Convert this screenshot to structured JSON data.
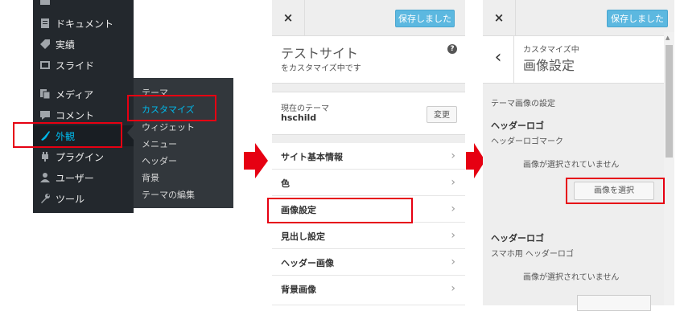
{
  "admin_menu": {
    "items": [
      {
        "label": "ドキュメント",
        "icon": "document-icon"
      },
      {
        "label": "実績",
        "icon": "tag-icon"
      },
      {
        "label": "スライド",
        "icon": "slides-icon"
      },
      {
        "label": "メディア",
        "icon": "media-icon"
      },
      {
        "label": "コメント",
        "icon": "comment-icon"
      },
      {
        "label": "外観",
        "icon": "brush-icon"
      },
      {
        "label": "プラグイン",
        "icon": "plugin-icon"
      },
      {
        "label": "ユーザー",
        "icon": "user-icon"
      },
      {
        "label": "ツール",
        "icon": "wrench-icon"
      }
    ],
    "submenu": [
      "テーマ",
      "カスタマイズ",
      "ウィジェット",
      "メニュー",
      "ヘッダー",
      "背景",
      "テーマの編集"
    ]
  },
  "customizer": {
    "close": "×",
    "saved": "保存しました",
    "site_title": "テストサイト",
    "site_subtitle": "をカスタマイズ中です",
    "help": "?",
    "current_theme_label": "現在のテーマ",
    "current_theme": "hschild",
    "change_button": "変更",
    "sections": [
      "サイト基本情報",
      "色",
      "画像設定",
      "見出し設定",
      "ヘッダー画像",
      "背景画像"
    ]
  },
  "image_settings": {
    "close": "×",
    "saved": "保存しました",
    "back": "‹",
    "breadcrumb": "カスタマイズ中",
    "title": "画像設定",
    "section_heading": "テーマ画像の設定",
    "header_logo_title": "ヘッダーロゴ",
    "header_logo_desc": "ヘッダーロゴマーク",
    "no_image": "画像が選択されていません",
    "select_image": "画像を選択",
    "mobile_logo_title": "ヘッダーロゴ",
    "mobile_logo_desc": "スマホ用 ヘッダーロゴ",
    "no_image_2": "画像が選択されていません"
  },
  "colors": {
    "highlight": "#e60012",
    "wp_dark": "#23282d",
    "accent": "#00b9eb",
    "save_blue": "#5cb8e0"
  }
}
